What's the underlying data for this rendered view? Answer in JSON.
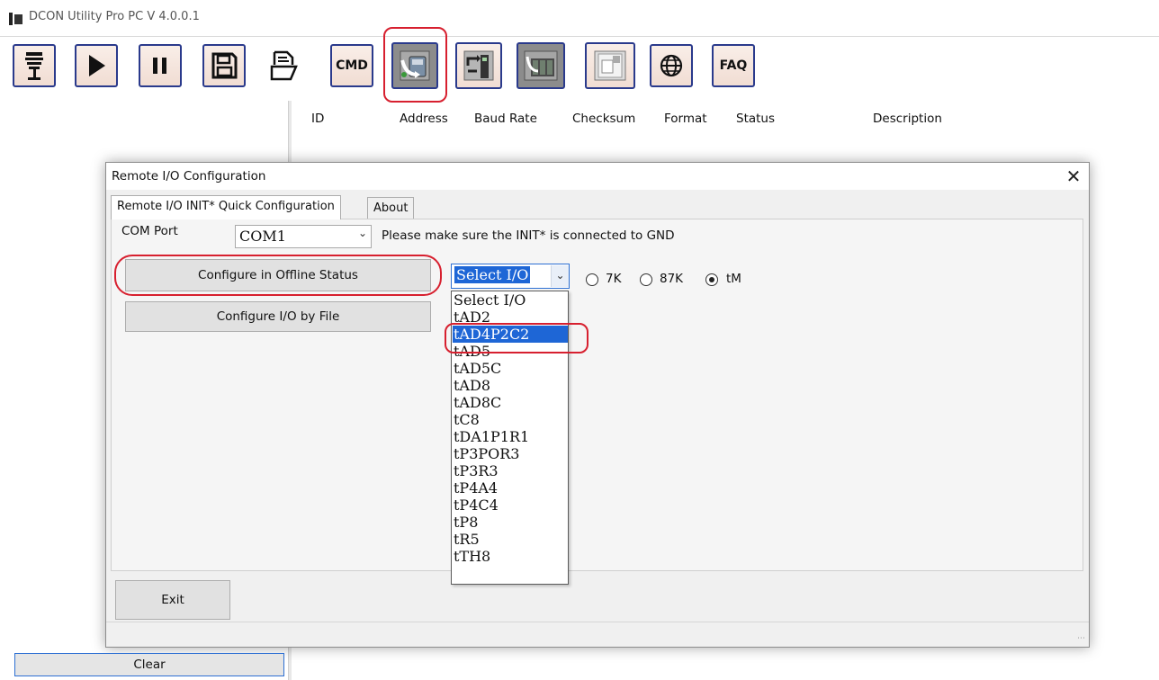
{
  "window": {
    "title": "DCON Utility Pro PC V 4.0.0.1"
  },
  "toolbar": {
    "buttons": [
      {
        "name": "connect-button",
        "icon": "connector-icon"
      },
      {
        "name": "run-button",
        "icon": "play-icon"
      },
      {
        "name": "pause-button",
        "icon": "pause-icon"
      },
      {
        "name": "save-button",
        "icon": "save-icon"
      },
      {
        "name": "open-button",
        "icon": "open-file-icon"
      },
      {
        "name": "cmd-button",
        "label": "CMD"
      },
      {
        "name": "remote-io-config-button",
        "icon": "io-config-icon"
      },
      {
        "name": "firmware-button",
        "icon": "firmware-icon"
      },
      {
        "name": "module-search-button",
        "icon": "module-icon"
      },
      {
        "name": "window-tool-button",
        "icon": "window-icon"
      },
      {
        "name": "web-button",
        "icon": "globe-icon"
      },
      {
        "name": "faq-button",
        "label": "FAQ"
      }
    ]
  },
  "table": {
    "columns": [
      "ID",
      "Address",
      "Baud Rate",
      "Checksum",
      "Format",
      "Status",
      "Description"
    ]
  },
  "dialog": {
    "title": "Remote I/O Configuration",
    "close_symbol": "✕",
    "tabs": [
      "Remote I/O INIT* Quick Configuration",
      "About"
    ],
    "com_port": {
      "label": "COM Port",
      "value": "COM1",
      "note": "Please make sure the INIT* is connected to GND"
    },
    "buttons": {
      "offline": "Configure in Offline Status",
      "by_file": "Configure I/O by File",
      "exit": "Exit"
    },
    "io_select": {
      "value": "Select I/O",
      "options": [
        "Select I/O",
        "tAD2",
        "tAD4P2C2",
        "tAD5",
        "tAD5C",
        "tAD8",
        "tAD8C",
        "tC8",
        "tDA1P1R1",
        "tP3POR3",
        "tP3R3",
        "tP4A4",
        "tP4C4",
        "tP8",
        "tR5",
        "tTH8"
      ],
      "highlighted": "tAD4P2C2"
    },
    "series_radio": {
      "options": [
        "7K",
        "87K",
        "tM"
      ],
      "selected": "tM"
    }
  },
  "bottom": {
    "clear_label": "Clear"
  },
  "colors": {
    "highlight": "#d7202f",
    "selection": "#1e66d6",
    "toolbar_border": "#2a3a8c"
  }
}
